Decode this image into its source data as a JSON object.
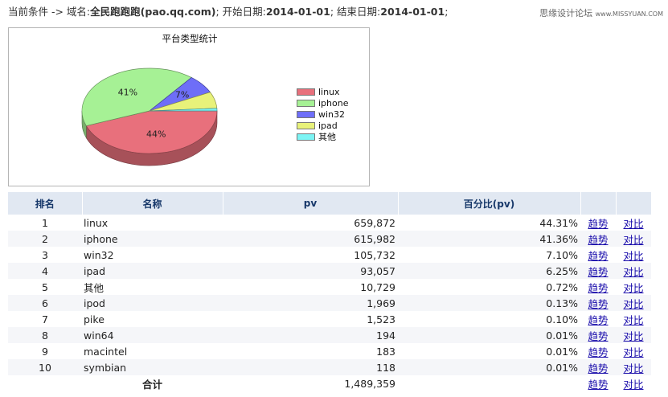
{
  "condition": {
    "prefix": "当前条件 -> 域名:",
    "domain_value": "全民跑跑跑(pao.qq.com)",
    "start_label": "; 开始日期:",
    "start_value": "2014-01-01",
    "end_label": "; 结束日期:",
    "end_value": "2014-01-01",
    "suffix": ";"
  },
  "watermark": {
    "cn": "思缘设计论坛",
    "en": "www.MISSYUAN.COM"
  },
  "chart_data": {
    "type": "pie",
    "title": "平台类型统计",
    "categories": [
      "linux",
      "iphone",
      "win32",
      "ipad",
      "其他"
    ],
    "values": [
      44.31,
      41.36,
      7.1,
      6.25,
      0.98
    ],
    "slice_labels": [
      "44%",
      "41%",
      "7%",
      "",
      ""
    ],
    "colors": [
      "#e8707c",
      "#a6f195",
      "#6e6ef8",
      "#e8f27a",
      "#7cf4f4"
    ],
    "legend_position": "right"
  },
  "table": {
    "headers": [
      "排名",
      "名称",
      "pv",
      "百分比(pv)",
      "",
      ""
    ],
    "rows": [
      {
        "rank": "1",
        "name": "linux",
        "pv": "659,872",
        "pct": "44.31%"
      },
      {
        "rank": "2",
        "name": "iphone",
        "pv": "615,982",
        "pct": "41.36%"
      },
      {
        "rank": "3",
        "name": "win32",
        "pv": "105,732",
        "pct": "7.10%"
      },
      {
        "rank": "4",
        "name": "ipad",
        "pv": "93,057",
        "pct": "6.25%"
      },
      {
        "rank": "5",
        "name": "其他",
        "pv": "10,729",
        "pct": "0.72%"
      },
      {
        "rank": "6",
        "name": "ipod",
        "pv": "1,969",
        "pct": "0.13%"
      },
      {
        "rank": "7",
        "name": "pike",
        "pv": "1,523",
        "pct": "0.10%"
      },
      {
        "rank": "8",
        "name": "win64",
        "pv": "194",
        "pct": "0.01%"
      },
      {
        "rank": "9",
        "name": "macintel",
        "pv": "183",
        "pct": "0.01%"
      },
      {
        "rank": "10",
        "name": "symbian",
        "pv": "118",
        "pct": "0.01%"
      }
    ],
    "trend_label": "趋势",
    "compare_label": "对比",
    "total_label": "合计",
    "total_pv": "1,489,359"
  }
}
